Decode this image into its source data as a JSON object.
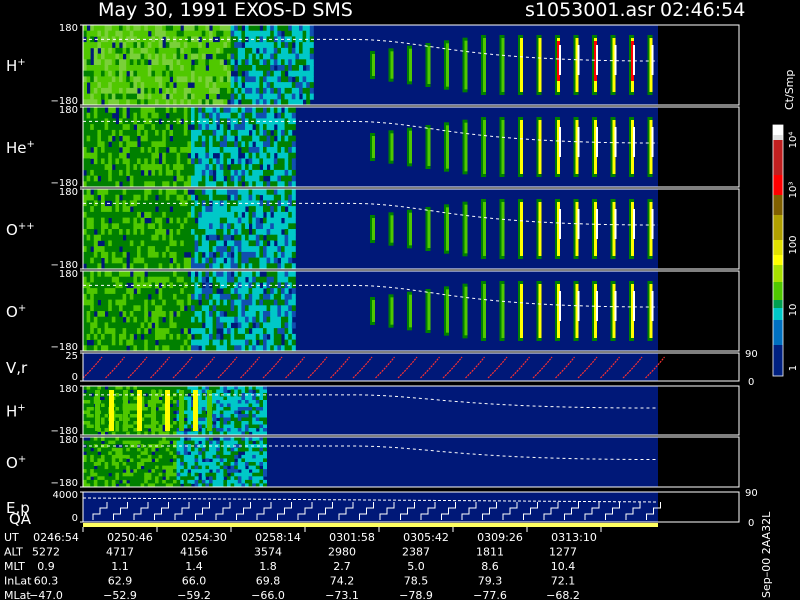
{
  "header": {
    "title": "May 30, 1991   EXOS-D SMS",
    "file": "s1053001.asr",
    "time": "02:46:54"
  },
  "chart_data": {
    "type": "heatmap",
    "panels": [
      {
        "label": "H+",
        "ion": "H",
        "sup": "+",
        "ymax": "180",
        "ymin": "−180"
      },
      {
        "label": "He+",
        "ion": "He",
        "sup": "+",
        "ymax": "180",
        "ymin": "−180"
      },
      {
        "label": "O++",
        "ion": "O",
        "sup": "++",
        "ymax": "180",
        "ymin": "−180"
      },
      {
        "label": "O+",
        "ion": "O",
        "sup": "+",
        "ymax": "180",
        "ymin": "−180"
      },
      {
        "label": "V,r",
        "ion": "V,r",
        "sup": "",
        "ymax": "25",
        "ymin": "0",
        "rmax": "90",
        "rmin": "0"
      },
      {
        "label": "H+",
        "ion": "H",
        "sup": "+",
        "ymax": "180",
        "ymin": "−180"
      },
      {
        "label": "O+",
        "ion": "O",
        "sup": "+",
        "ymax": "180",
        "ymin": "−180"
      },
      {
        "label": "E,p",
        "ion": "E,p",
        "sup": "",
        "ymax": "4000",
        "ymin": "0",
        "rmax": "90",
        "rmin": "0",
        "sub": "QA"
      }
    ],
    "colorbar": {
      "label": "Ct/Smp",
      "ticks": [
        "10⁴",
        "10³",
        "100",
        "10",
        "1"
      ],
      "colors": [
        "#ffffff",
        "#ff0000",
        "#b0a000",
        "#ffff00",
        "#50c800",
        "#008000",
        "#00c8c8",
        "#0030a0",
        "#002080"
      ]
    },
    "footer": {
      "side": "Sep–00 2AA32L",
      "rows": [
        {
          "label": "UT",
          "values": [
            "0246:54",
            "0250:46",
            "0254:30",
            "0258:14",
            "0301:58",
            "0305:42",
            "0309:26",
            "0313:10"
          ]
        },
        {
          "label": "ALT",
          "values": [
            "5272",
            "4717",
            "4156",
            "3574",
            "2980",
            "2387",
            "1811",
            "1277"
          ]
        },
        {
          "label": "MLT",
          "values": [
            "0.9",
            "1.1",
            "1.4",
            "1.8",
            "2.7",
            "5.0",
            "8.6",
            "10.4"
          ]
        },
        {
          "label": "InLat",
          "values": [
            "60.3",
            "62.9",
            "66.0",
            "69.8",
            "74.2",
            "78.5",
            "79.3",
            "72.1"
          ]
        },
        {
          "label": "MLat",
          "values": [
            "−47.0",
            "−52.9",
            "−59.2",
            "−66.0",
            "−73.1",
            "−78.9",
            "−77.6",
            "−68.2"
          ]
        }
      ]
    }
  }
}
